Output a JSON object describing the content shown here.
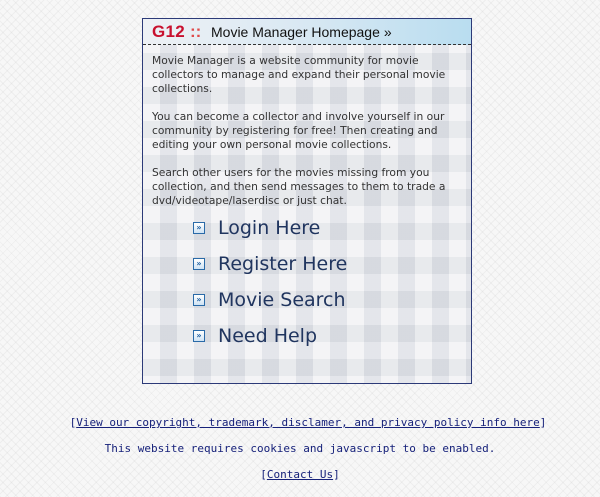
{
  "header": {
    "brand": "G12",
    "separator": "::",
    "title": "Movie Manager Homepage",
    "arrow": "»"
  },
  "intro": [
    "Movie Manager is a website community for movie collectors to manage and expand their personal movie collections.",
    "You can become a collector and involve yourself in our community by registering for free! Then creating and editing your own personal movie collections.",
    "Search other users for the movies missing from you collection, and then send messages to them to trade a dvd/videotape/laserdisc or just chat."
  ],
  "nav": [
    {
      "label": "Login Here",
      "icon": "double-chevron-right-icon"
    },
    {
      "label": "Register Here",
      "icon": "double-chevron-right-icon"
    },
    {
      "label": "Movie Search",
      "icon": "double-chevron-right-icon"
    },
    {
      "label": "Need Help",
      "icon": "double-chevron-right-icon"
    }
  ],
  "nav_icon_glyph": "»",
  "footer": {
    "open_bracket": "[",
    "close_bracket": "]",
    "policy_link": "View our copyright, trademark, disclamer, and privacy policy info here",
    "cookies_notice": "This website requires cookies and javascript to be enabled.",
    "contact_link": "Contact Us"
  },
  "colors": {
    "brand_red": "#c8102e",
    "link_blue": "#16217a",
    "nav_text": "#20355f",
    "panel_border": "#2c3a78"
  }
}
